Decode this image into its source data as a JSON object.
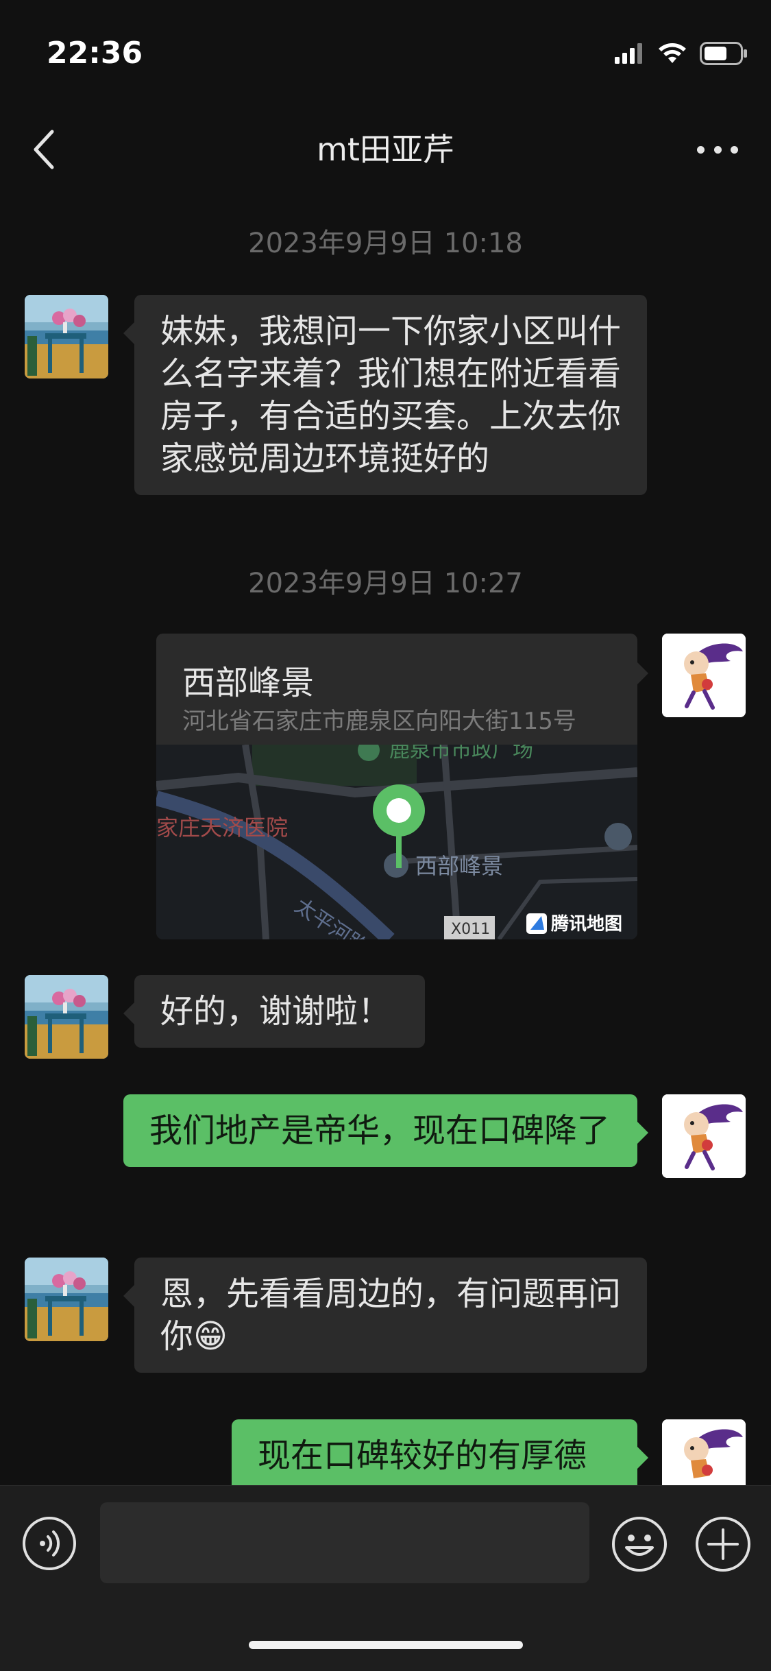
{
  "status": {
    "time": "22:36"
  },
  "nav": {
    "title": "mt田亚芹"
  },
  "messages": {
    "ts1": "2023年9月9日 10:18",
    "m1": "妹妹，我想问一下你家小区叫什么名字来着？我们想在附近看看房子，有合适的买套。上次去你家感觉周边环境挺好的",
    "ts2": "2023年9月9日 10:27",
    "location": {
      "name": "西部峰景",
      "address": "河北省石家庄市鹿泉区向阳大街115号",
      "map_labels": {
        "top": "鹿泉市市政广场",
        "hospital": "家庄天济医院",
        "river": "太平河路",
        "pin": "西部峰景",
        "road": "X011",
        "brand": "腾讯地图"
      }
    },
    "m3": "好的，谢谢啦！",
    "m4": "我们地产是帝华，现在口碑降了",
    "m5": "恩，先看看周边的，有问题再问你😁",
    "m6": "现在口碑较好的有厚德"
  },
  "input": {
    "placeholder": ""
  },
  "colors": {
    "bg": "#111111",
    "bubble_in": "#2b2b2b",
    "bubble_out": "#5bbf66",
    "pin": "#5bbf66"
  },
  "icons": [
    "back-arrow-icon",
    "more-dots-icon",
    "voice-icon",
    "emoji-icon",
    "plus-icon",
    "signal-icon",
    "wifi-icon",
    "battery-icon"
  ]
}
